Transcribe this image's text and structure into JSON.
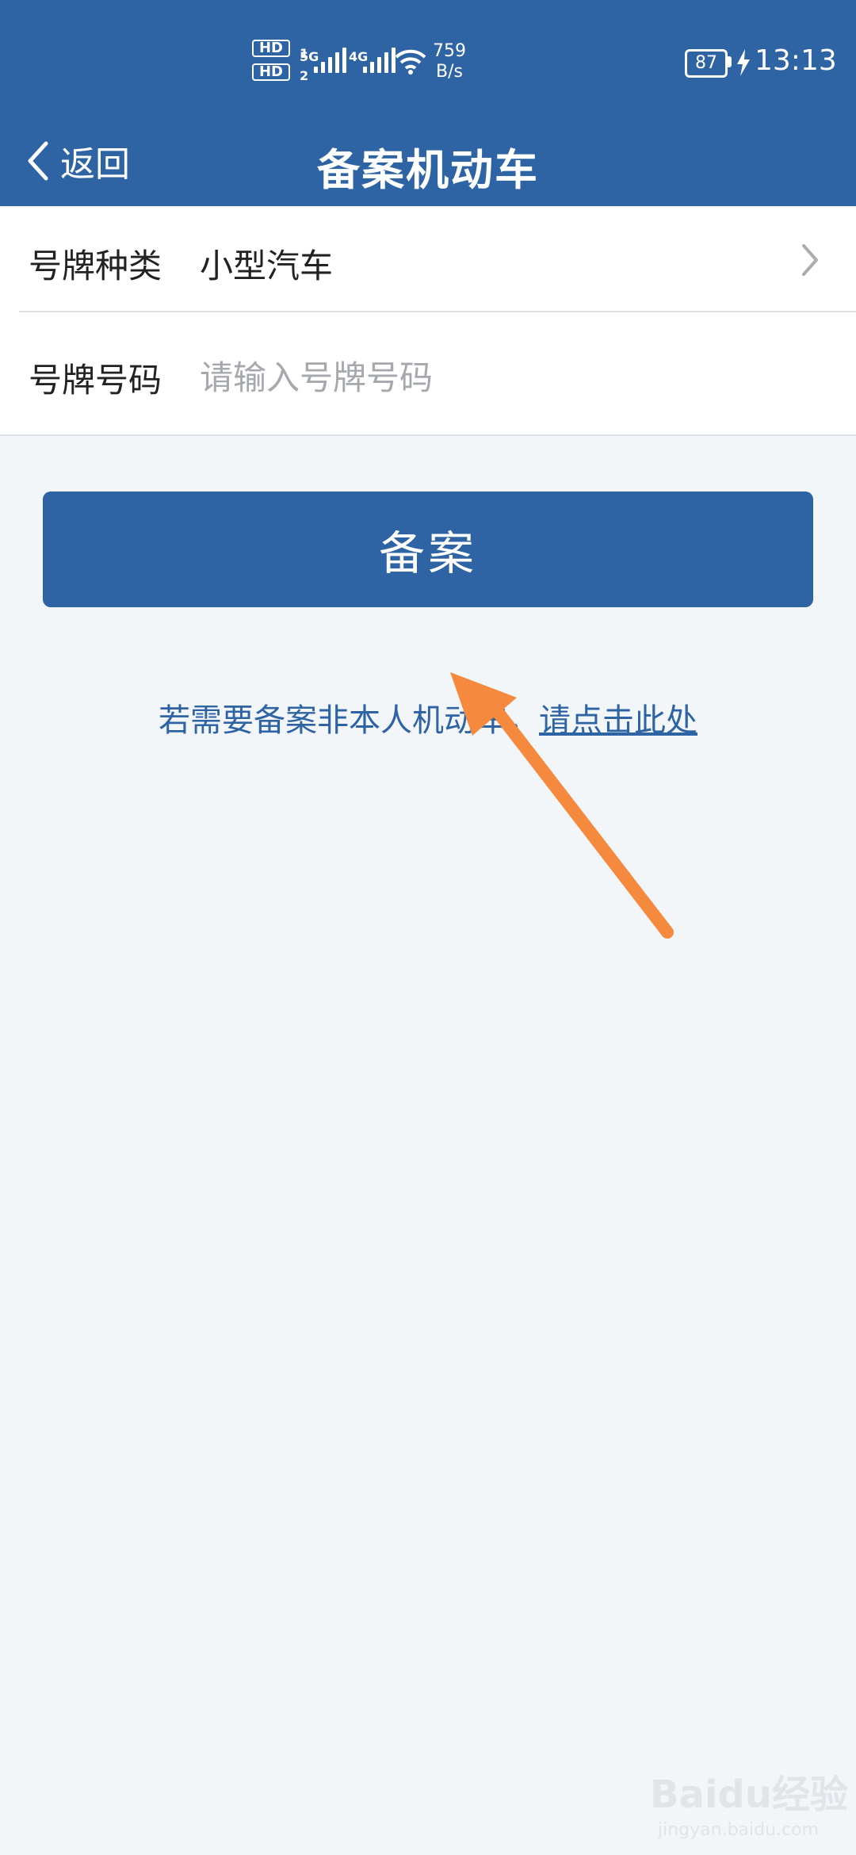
{
  "status_bar": {
    "hd1": "HD",
    "hd2": "HD",
    "sim1": "1",
    "sim2": "2",
    "net1": "5G",
    "net2": "4G",
    "speed_value": "759",
    "speed_unit": "B/s",
    "battery": "87",
    "time": "13:13"
  },
  "nav": {
    "back_label": "返回",
    "title": "备案机动车"
  },
  "form": {
    "plate_type_label": "号牌种类",
    "plate_type_value": "小型汽车",
    "plate_number_label": "号牌号码",
    "plate_number_placeholder": "请输入号牌号码",
    "plate_number_value": ""
  },
  "submit_label": "备案",
  "note": {
    "text": "若需要备案非本人机动车，",
    "link": "请点击此处"
  },
  "watermark": {
    "brand": "Baidu经验",
    "url": "jingyan.baidu.com"
  },
  "colors": {
    "brand": "#2e63a4",
    "annotation_arrow": "#f58a3e"
  }
}
